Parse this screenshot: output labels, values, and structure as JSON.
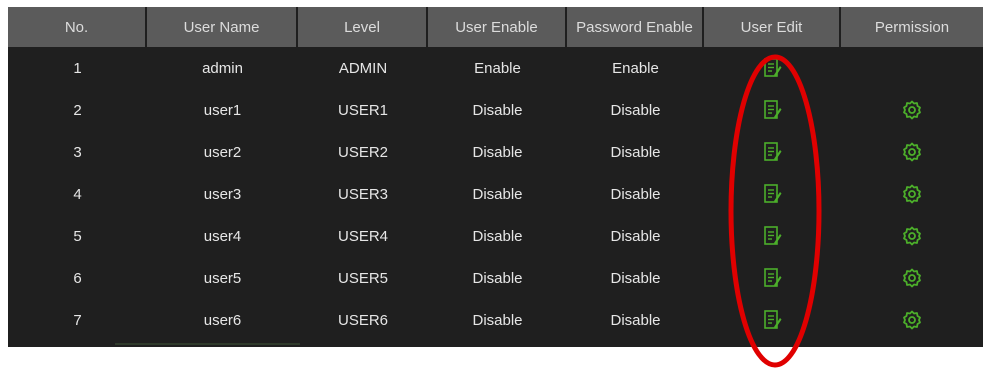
{
  "table": {
    "headers": [
      "No.",
      "User Name",
      "Level",
      "User Enable",
      "Password Enable",
      "User Edit",
      "Permission"
    ],
    "rows": [
      {
        "no": "1",
        "name": "admin",
        "level": "ADMIN",
        "user_enable": "Enable",
        "password_enable": "Enable",
        "edit_icon": "edit-icon",
        "permission_icon": ""
      },
      {
        "no": "2",
        "name": "user1",
        "level": "USER1",
        "user_enable": "Disable",
        "password_enable": "Disable",
        "edit_icon": "edit-icon",
        "permission_icon": "gear-icon"
      },
      {
        "no": "3",
        "name": "user2",
        "level": "USER2",
        "user_enable": "Disable",
        "password_enable": "Disable",
        "edit_icon": "edit-icon",
        "permission_icon": "gear-icon"
      },
      {
        "no": "4",
        "name": "user3",
        "level": "USER3",
        "user_enable": "Disable",
        "password_enable": "Disable",
        "edit_icon": "edit-icon",
        "permission_icon": "gear-icon"
      },
      {
        "no": "5",
        "name": "user4",
        "level": "USER4",
        "user_enable": "Disable",
        "password_enable": "Disable",
        "edit_icon": "edit-icon",
        "permission_icon": "gear-icon"
      },
      {
        "no": "6",
        "name": "user5",
        "level": "USER5",
        "user_enable": "Disable",
        "password_enable": "Disable",
        "edit_icon": "edit-icon",
        "permission_icon": "gear-icon"
      },
      {
        "no": "7",
        "name": "user6",
        "level": "USER6",
        "user_enable": "Disable",
        "password_enable": "Disable",
        "edit_icon": "edit-icon",
        "permission_icon": "gear-icon"
      }
    ]
  },
  "colors": {
    "panel_bg": "#1f1f1f",
    "header_bg": "#5b5b5b",
    "icon_green": "#4caf2a",
    "annotation_red": "#e00000"
  }
}
